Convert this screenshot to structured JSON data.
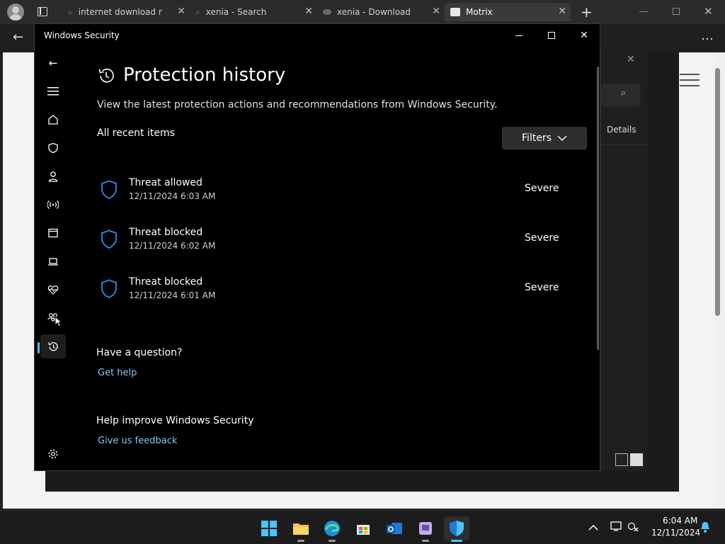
{
  "browser": {
    "tabs": [
      {
        "title": "internet download ma",
        "icon": "search-icon"
      },
      {
        "title": "xenia - Search",
        "icon": "search-icon"
      },
      {
        "title": "xenia - Download",
        "icon": "globe-icon"
      },
      {
        "title": "Motrix",
        "icon": "app-icon"
      }
    ],
    "new_tab": "+",
    "details_label": "Details"
  },
  "security": {
    "window_title": "Windows Security",
    "page_title": "Protection history",
    "description": "View the latest protection actions and recommendations from Windows Security.",
    "section_label": "All recent items",
    "filters_label": "Filters",
    "items": [
      {
        "name": "Threat allowed",
        "date": "12/11/2024 6:03 AM",
        "severity": "Severe"
      },
      {
        "name": "Threat blocked",
        "date": "12/11/2024 6:02 AM",
        "severity": "Severe"
      },
      {
        "name": "Threat blocked",
        "date": "12/11/2024 6:01 AM",
        "severity": "Severe"
      }
    ],
    "question_heading": "Have a question?",
    "get_help": "Get help",
    "improve_heading": "Help improve Windows Security",
    "feedback": "Give us feedback"
  },
  "taskbar": {
    "time": "6:04 AM",
    "date": "12/11/2024"
  },
  "colors": {
    "accent": "#4cc2ff",
    "shield": "#2f7fd8",
    "link": "#7fc9f5"
  }
}
